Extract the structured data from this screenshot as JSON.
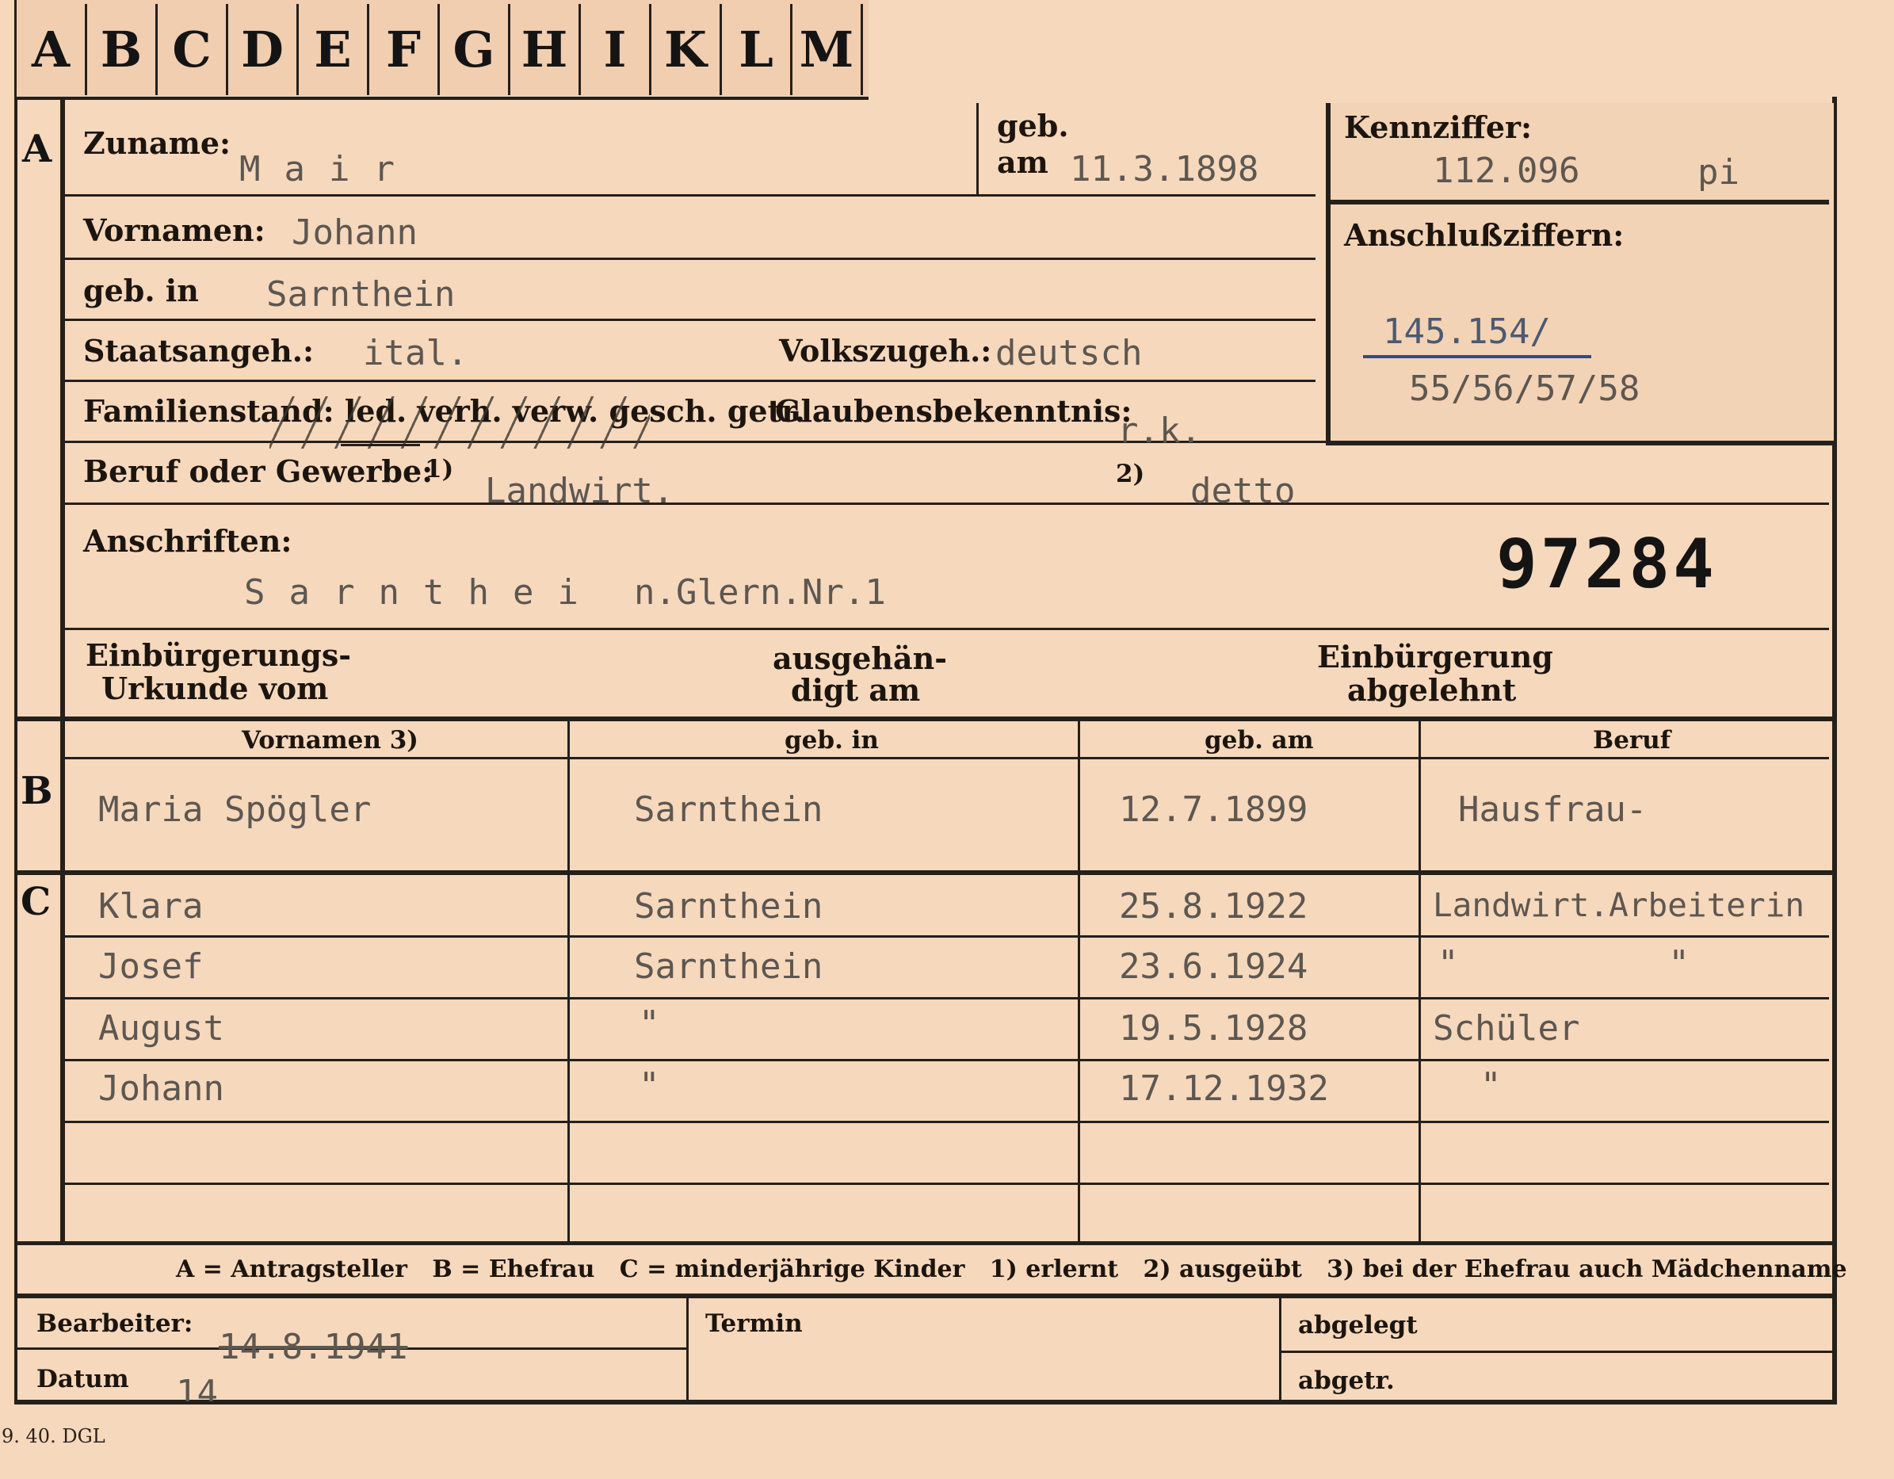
{
  "index_tabs": [
    "A",
    "B",
    "C",
    "D",
    "E",
    "F",
    "G",
    "H",
    "I",
    "K",
    "L",
    "M"
  ],
  "sections": {
    "a": "A",
    "b": "B",
    "c": "C"
  },
  "labels": {
    "zuname": "Zuname:",
    "geb": "geb.",
    "am": "am",
    "kennziffer": "Kennziffer:",
    "anschlussziffern": "Anschlußziffern:",
    "vornamen": "Vornamen:",
    "geb_in": "geb. in",
    "staatsangeh": "Staatsangeh.:",
    "volkszugeh": "Volkszugeh.:",
    "familienstand": "Familienstand: led. verh. verw. gesch. getr.",
    "glaubensbekenntnis": "Glaubensbekenntnis:",
    "beruf": "Beruf oder Gewerbe:",
    "fn1": "1)",
    "fn2": "2)",
    "anschriften": "Anschriften:",
    "einbuergerungs_1": "Einbürgerungs-",
    "einbuergerungs_2": "Urkunde vom",
    "ausgehaendigt_1": "ausgehän-",
    "ausgehaendigt_2": "digt am",
    "abgelehnt_1": "Einbürgerung",
    "abgelehnt_2": "abgelehnt"
  },
  "applicant": {
    "surname": "Mair",
    "birth_date": "11.3.1898",
    "kennziffer": "112.096",
    "kennziffer_suffix": "pi",
    "anschluss_line1": "145.154/",
    "anschluss_line2": "55/56/57/58",
    "first_names": "Johann",
    "birthplace": "Sarnthein",
    "citizenship": "ital.",
    "ethnicity": "deutsch",
    "religion": "r.k.",
    "occupation_learned": "Landwirt.",
    "occupation_practiced": "detto",
    "address_prefix": "Sarnthei",
    "address_rest": "n.Glern.Nr.1",
    "file_number": "97284"
  },
  "family_table": {
    "headers": [
      "Vornamen 3)",
      "geb. in",
      "geb. am",
      "Beruf"
    ],
    "spouse": {
      "name": "Maria Spögler",
      "birthplace": "Sarnthein",
      "birth_date": "12.7.1899",
      "occupation": "Hausfrau-"
    },
    "children": [
      {
        "name": "Klara",
        "birthplace": "Sarnthein",
        "birth_date": "25.8.1922",
        "occupation": "Landwirt.Arbeiterin"
      },
      {
        "name": "Josef",
        "birthplace": "Sarnthein",
        "birth_date": "23.6.1924",
        "occupation": "\"          \""
      },
      {
        "name": "August",
        "birthplace": "\"",
        "birth_date": "19.5.1928",
        "occupation": "Schüler"
      },
      {
        "name": "Johann",
        "birthplace": "\"",
        "birth_date": "17.12.1932",
        "occupation": "\""
      },
      {
        "name": "",
        "birthplace": "",
        "birth_date": "",
        "occupation": ""
      },
      {
        "name": "",
        "birthplace": "",
        "birth_date": "",
        "occupation": ""
      }
    ]
  },
  "legend": "A = Antragsteller   B = Ehefrau   C = minderjährige Kinder   1) erlernt   2) ausgeübt   3) bei der Ehefrau auch Mädchenname",
  "footer": {
    "bearbeiter_label": "Bearbeiter:",
    "bearbeiter_value": "14.8.1941",
    "datum_label": "Datum",
    "datum_value": "14",
    "termin_label": "Termin",
    "abgelegt_label": "abgelegt",
    "abgetr_label": "abgetr.",
    "print_mark": "9. 40. DGL"
  },
  "colors": {
    "card": "#f6d8bc",
    "ink": "#1c150f",
    "typewriter": "#5d5751",
    "blue_ink": "#2c4f86"
  }
}
